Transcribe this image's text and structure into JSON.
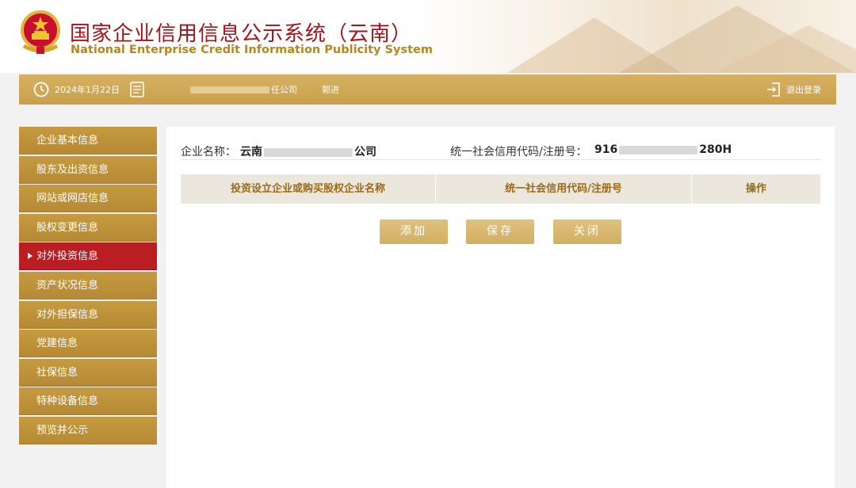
{
  "header": {
    "title_cn": "国家企业信用信息公示系统（云南）",
    "title_en": "National Enterprise Credit Information Publicity System"
  },
  "toolbar": {
    "date": "2024年1月22日",
    "company_short": "任公司",
    "user": "郭进",
    "logout": "退出登录"
  },
  "sidebar": {
    "items": [
      {
        "label": "企业基本信息",
        "active": false
      },
      {
        "label": "股东及出资信息",
        "active": false
      },
      {
        "label": "网站或网店信息",
        "active": false
      },
      {
        "label": "股权变更信息",
        "active": false
      },
      {
        "label": "对外投资信息",
        "active": true
      },
      {
        "label": "资产状况信息",
        "active": false
      },
      {
        "label": "对外担保信息",
        "active": false
      },
      {
        "label": "党建信息",
        "active": false
      },
      {
        "label": "社保信息",
        "active": false
      },
      {
        "label": "特种设备信息",
        "active": false
      },
      {
        "label": "预览并公示",
        "active": false
      }
    ]
  },
  "main": {
    "company_label": "企业名称：",
    "company_prefix": "云南",
    "company_suffix": "公司",
    "credit_label": "统一社会信用代码/注册号：",
    "credit_prefix": "916",
    "credit_suffix": "280H",
    "table": {
      "columns": [
        "投资设立企业或购买股权企业名称",
        "统一社会信用代码/注册号",
        "操作"
      ],
      "rows": []
    },
    "buttons": {
      "add": "添加",
      "save": "保存",
      "close": "关闭"
    }
  },
  "colors": {
    "brand_gold": "#c9a04c",
    "active_red": "#ba1d22",
    "title_red": "#a6131a"
  }
}
